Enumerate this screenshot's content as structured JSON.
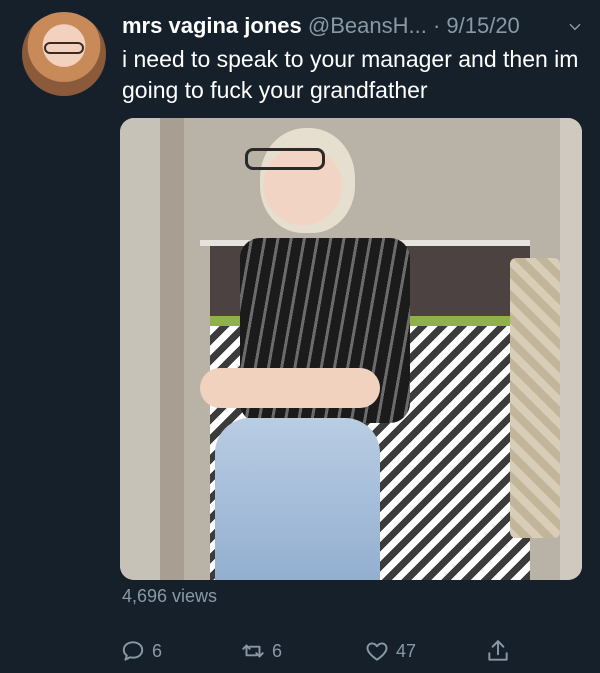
{
  "tweet": {
    "author_name": "mrs vagina jones",
    "handle": "@BeansH...",
    "date": "9/15/20",
    "text": "i need to speak to your manager and then im going to fuck your grandfather",
    "views": "4,696 views",
    "reply_count": "6",
    "retweet_count": "6",
    "like_count": "47"
  },
  "colors": {
    "background": "#15202b",
    "muted": "#8899a6",
    "text": "#ffffff"
  },
  "icons": [
    "chevron-down-icon",
    "reply-icon",
    "retweet-icon",
    "like-icon",
    "share-icon"
  ]
}
